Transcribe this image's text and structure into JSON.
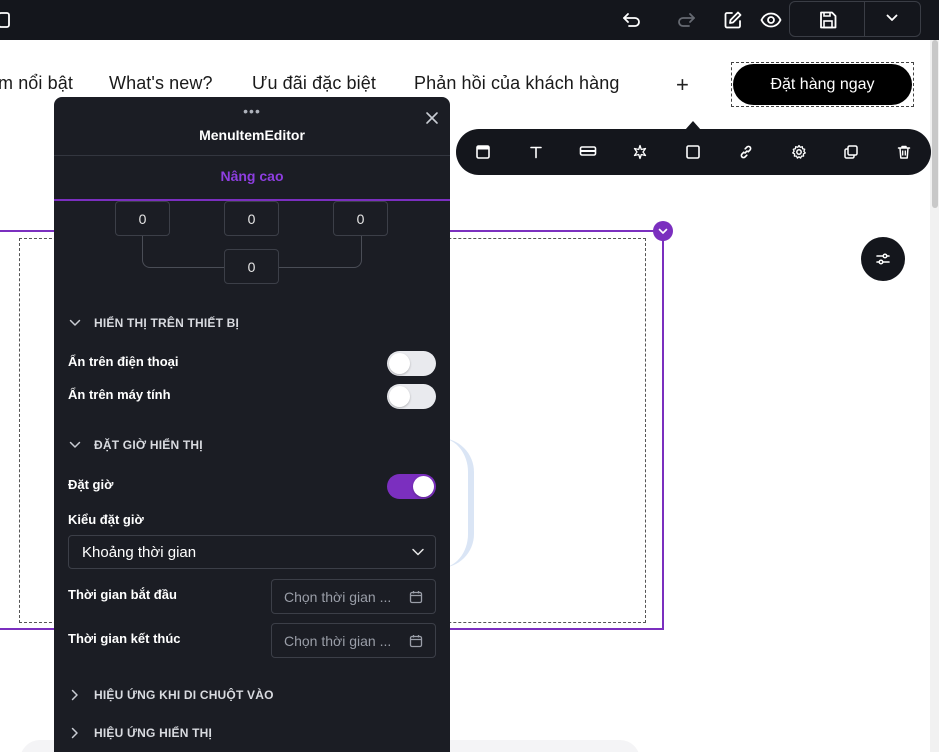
{
  "nav": {
    "items": [
      "m nổi bật",
      "What's new?",
      "Ưu đãi đặc biệt",
      "Phản hồi của khách hàng"
    ],
    "add_label": "+",
    "order_button": "Đặt hàng ngay"
  },
  "panel": {
    "title": "MenuItemEditor",
    "drag_dots": "•••",
    "active_tab": "Nâng cao",
    "spacing_values": [
      "0",
      "0",
      "0",
      "0"
    ],
    "device_section": {
      "title": "HIỂN THỊ TRÊN THIẾT BỊ",
      "hide_on_phone_label": "Ẩn trên điện thoại",
      "hide_on_phone": false,
      "hide_on_desktop_label": "Ẩn trên máy tính",
      "hide_on_desktop": false
    },
    "schedule_section": {
      "title": "ĐẶT GIỜ HIỂN THỊ",
      "schedule_label": "Đặt giờ",
      "schedule_enabled": true,
      "schedule_type_label": "Kiểu đặt giờ",
      "schedule_type_value": "Khoảng thời gian",
      "start_label": "Thời gian bắt đầu",
      "start_placeholder": "Chọn thời gian ...",
      "end_label": "Thời gian kết thúc",
      "end_placeholder": "Chọn thời gian ..."
    },
    "hover_section": {
      "title": "HIỆU ỨNG KHI DI CHUỘT VÀO"
    },
    "display_effect_section": {
      "title": "HIỆU ỨNG HIỂN THỊ"
    }
  },
  "colors": {
    "accent": "#7b2fbf",
    "dark": "#14161c",
    "panel_bg": "#1b1d24"
  }
}
